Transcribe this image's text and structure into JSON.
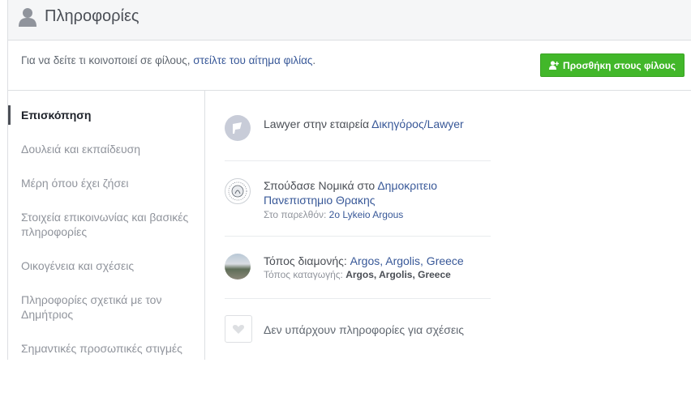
{
  "header": {
    "title": "Πληροφορίες"
  },
  "notice": {
    "prefix": "Για να δείτε τι κοινοποιεί σε φίλους, ",
    "link": "στείλτε του αίτημα φιλίας",
    "suffix": "."
  },
  "add_friend_button": "Προσθήκη στους φίλους",
  "sidebar": {
    "items": [
      "Επισκόπηση",
      "Δουλειά και εκπαίδευση",
      "Μέρη όπου έχει ζήσει",
      "Στοιχεία επικοινωνίας και βασικές πληροφορίες",
      "Οικογένεια και σχέσεις",
      "Πληροφορίες σχετικά με τον Δημήτριος",
      "Σημαντικές προσωπικές στιγμές"
    ]
  },
  "overview": {
    "work": {
      "prefix": "Lawyer στην εταιρεία ",
      "link": "Δικηγόρος/Lawyer"
    },
    "education": {
      "prefix": "Σπούδασε Νομικά στο ",
      "link": "Δημοκριτειο Πανεπιστημιο Θρακης",
      "sub_prefix": "Στο παρελθόν: ",
      "sub_link": "2ο Lykeio Argous"
    },
    "places": {
      "prefix": "Τόπος διαμονής: ",
      "link": "Argos, Argolis, Greece",
      "sub_prefix": "Τόπος καταγωγής: ",
      "sub_link": "Argos, Argolis, Greece"
    },
    "relationship": "Δεν υπάρχουν πληροφορίες για σχέσεις"
  },
  "colors": {
    "accent": "#385898",
    "button": "#42b72a"
  }
}
